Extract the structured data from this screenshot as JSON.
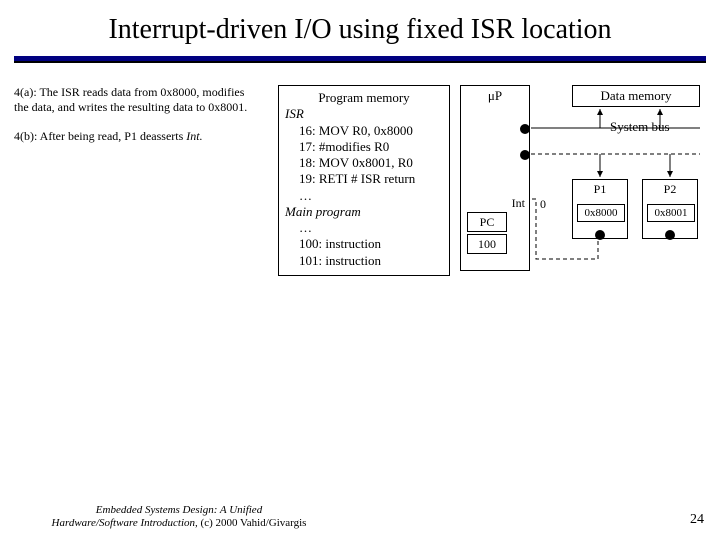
{
  "title": "Interrupt-driven I/O using fixed ISR location",
  "left": {
    "p1_label": "4(a):",
    "p1_text": " The ISR reads data from 0x8000, modifies the data, and writes the resulting data to 0x8001.",
    "p2_label": "4(b):",
    "p2_text": " After being read, P1 deasserts ",
    "p2_em": "Int."
  },
  "progmem": {
    "heading": "Program memory",
    "isr_label": "ISR",
    "rows": [
      "16:  MOV R0, 0x8000",
      "17:  #modifies R0",
      "18:  MOV 0x8001, R0",
      "19:  RETI  # ISR return",
      "…"
    ],
    "main_label": "Main program",
    "main_rows": [
      "…",
      "100: instruction",
      "101: instruction"
    ]
  },
  "uP": {
    "label": "μP",
    "int": "Int",
    "pc": "PC",
    "pcval": "100"
  },
  "zero": "0",
  "datamem": "Data memory",
  "sysbus": "System bus",
  "p1": {
    "label": "P1",
    "addr": "0x8000"
  },
  "p2": {
    "label": "P2",
    "addr": "0x8001"
  },
  "footer": {
    "line1": "Embedded Systems Design: A Unified",
    "line2": "Hardware/Software Introduction,",
    "copy": " (c) 2000 Vahid/Givargis"
  },
  "page": "24"
}
